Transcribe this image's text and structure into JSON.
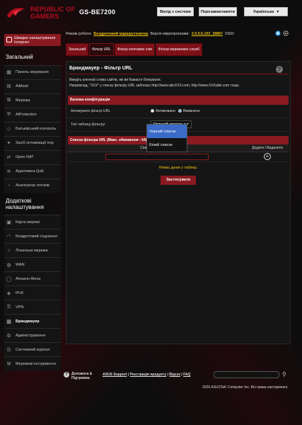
{
  "header": {
    "brand_line1": "REPUBLIC OF",
    "brand_line2": "GAMERS",
    "model": "GS-BE7200",
    "logout_label": "Вихід з системи",
    "reboot_label": "Перезавантажити",
    "language": "Українська"
  },
  "sidebar": {
    "quick_setup": "Швидке налаштування Інтернет",
    "general_title": "Загальний",
    "general_items": [
      {
        "label": "Панель керування",
        "icon": "dashboard-icon"
      },
      {
        "label": "AiMesh",
        "icon": "mesh-icon"
      },
      {
        "label": "Мережа",
        "icon": "network-icon"
      },
      {
        "label": "AiProtection",
        "icon": "shield-icon"
      },
      {
        "label": "Батьківський контроль",
        "icon": "parental-icon"
      },
      {
        "label": "Засіб оптимізації ігор",
        "icon": "game-icon"
      },
      {
        "label": "Open NAT",
        "icon": "nat-icon"
      },
      {
        "label": "Адаптивна QoE",
        "icon": "qos-icon"
      },
      {
        "label": "Аналізатор потоків",
        "icon": "traffic-icon"
      }
    ],
    "advanced_title": "Додаткові налаштування",
    "advanced_items": [
      {
        "label": "Карта мережі",
        "icon": "map-icon"
      },
      {
        "label": "Бездротовий з'єднання",
        "icon": "wifi-icon"
      },
      {
        "label": "Локальна мережа",
        "icon": "lan-icon"
      },
      {
        "label": "WAN",
        "icon": "globe-icon"
      },
      {
        "label": "Amazon Alexa",
        "icon": "alexa-icon"
      },
      {
        "label": "IPv6",
        "icon": "ipv6-icon"
      },
      {
        "label": "VPN",
        "icon": "vpn-icon"
      },
      {
        "label": "Брандмауер",
        "icon": "firewall-icon"
      },
      {
        "label": "Адміністрування",
        "icon": "admin-icon"
      },
      {
        "label": "Системний журнал",
        "icon": "log-icon"
      },
      {
        "label": "Мережеві інструменти",
        "icon": "tools-icon"
      }
    ]
  },
  "status": {
    "mode_label": "Режим роботи:",
    "mode_value": "Бездротовий маршрутизатор",
    "fw_label": "Версія мікропрограми:",
    "fw_value": "3.0.0.6.102_18867",
    "ssid_label": "SSID:",
    "ssid_value": ""
  },
  "tabs": [
    {
      "label": "Загальний",
      "active": false
    },
    {
      "label": "Фільтр URL",
      "active": true
    },
    {
      "label": "Фільтр ключових слів",
      "active": false
    },
    {
      "label": "Фільтр мережевих служб",
      "active": false
    }
  ],
  "page": {
    "title": "Брандмауер - Фільтр URL",
    "desc_line1": "Введіть ключові слова сайтів, які ви бажаєте блокувати.",
    "desc_line2": "Наприклад, \"XXX\" у списку фільтру URL заблокує http://www.abcXXX.com, http://www.XXXabb.com тощо.",
    "config_header": "Базова конфігурація",
    "enable_label": "Активувати фільтр URL",
    "enable_on": "Активовано",
    "enable_off": "Вимкнено",
    "type_label": "Тип таблиці фільтру:",
    "type_value": "Чорний список",
    "list_header": "Список фільтра URL (Макс. обмеження : 64)",
    "col_list": "Список фільтра URL",
    "col_add": "Додати / Видалити",
    "empty_msg": "Немає даних у таблиці.",
    "apply_label": "Застосувати",
    "dropdown_options": [
      "Чорний список",
      "Білий список"
    ]
  },
  "footer": {
    "help_line1": "Допомога &",
    "help_line2": "Підтримка",
    "link1": "ASUS Support",
    "link2": "Реєстрація продукту",
    "link3": "Відгук",
    "link4": "FAQ",
    "copyright": "2026 ASUSTeK Computer Inc. Всі права застережені."
  },
  "colors": {
    "accent": "#8a1a21",
    "brand": "#b50e1e",
    "highlight": "#f1c40f",
    "selected": "#3b6bc8"
  }
}
